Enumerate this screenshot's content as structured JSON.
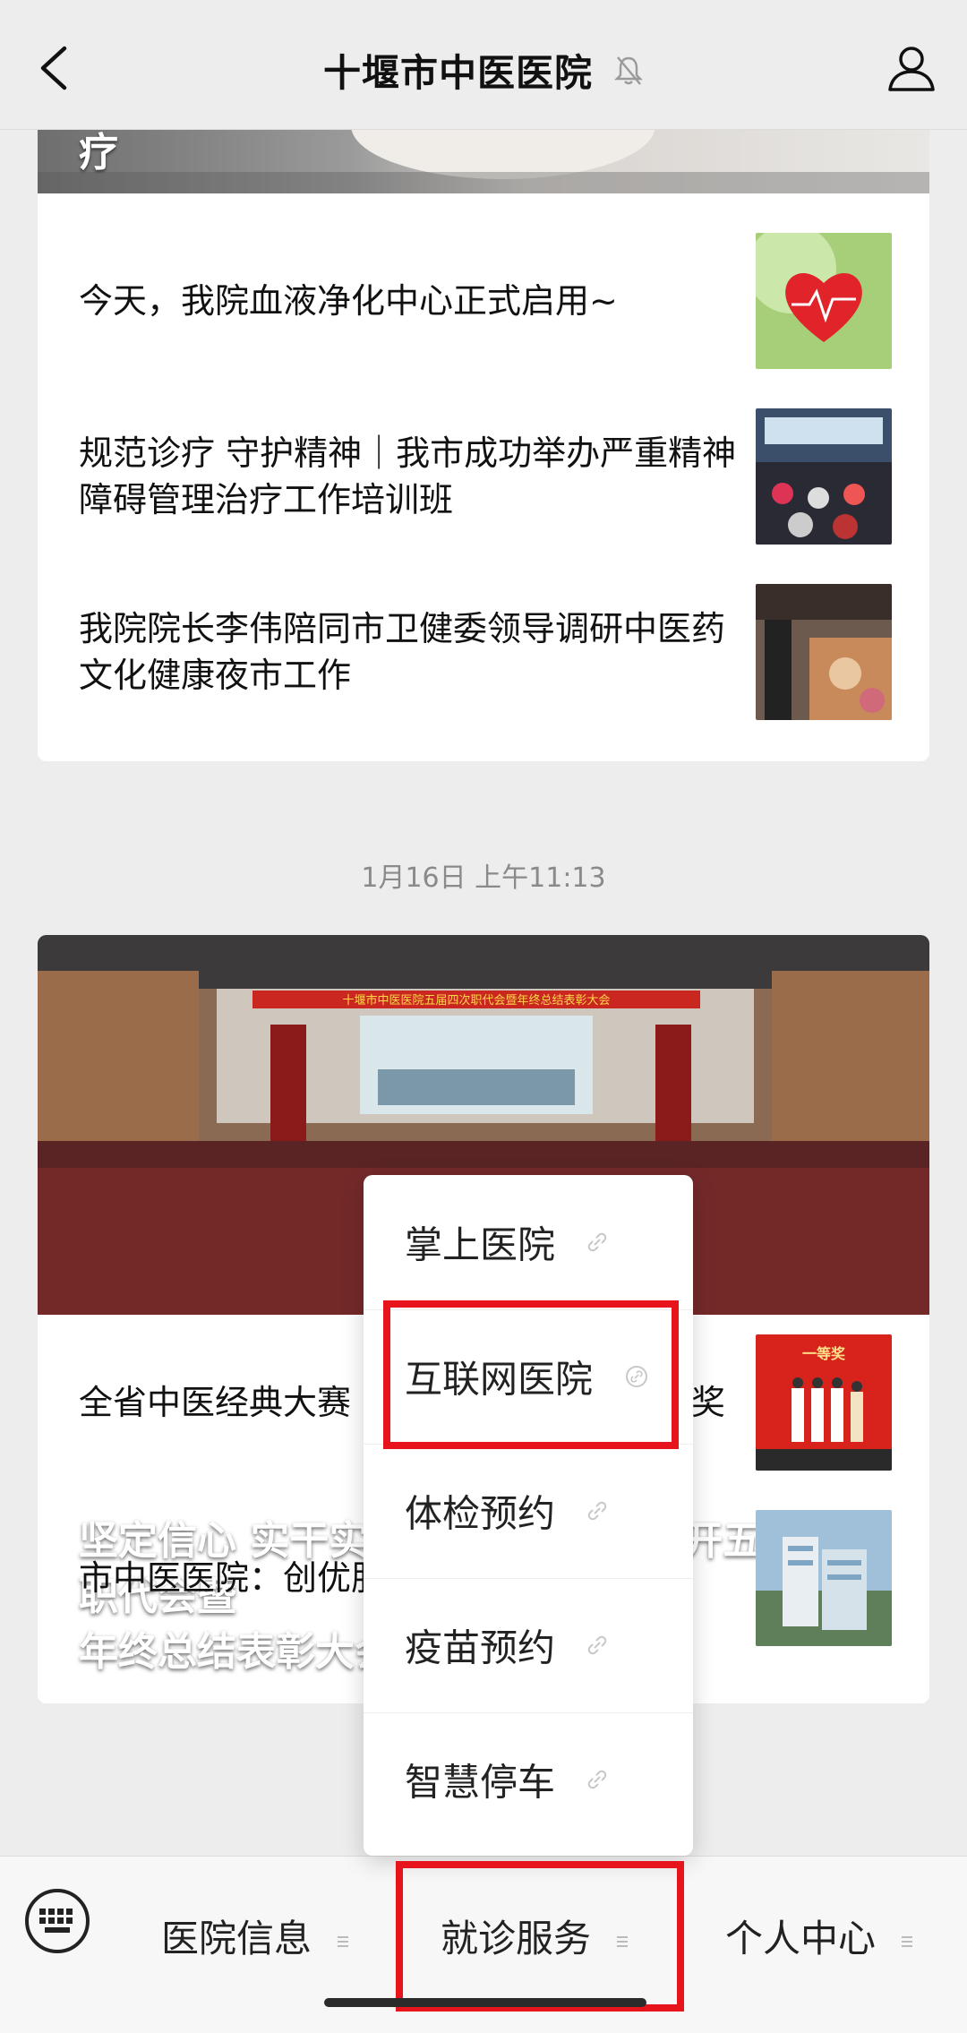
{
  "header": {
    "title": "十堰市中医医院"
  },
  "first_card": {
    "hero_caption_fragment": "疗",
    "news": [
      {
        "title": "今天，我院血液净化中心正式启用~"
      },
      {
        "title": "规范诊疗 守护精神｜我市成功举办严重精神障碍管理治疗工作培训班"
      },
      {
        "title": "我院院长李伟陪同市卫健委领导调研中医药文化健康夜市工作"
      }
    ]
  },
  "timestamp": "1月16日 上午11:13",
  "second_card": {
    "hero_caption_line1": "坚定信心 实干实效｜市中医医院召开五届四次职代会暨",
    "hero_caption_line2": "年终总结表彰大会",
    "stage_banner": "十堰市中医医院五届四次职代会暨年终总结表彰大会",
    "news": [
      {
        "title": "全省中医经典大赛｜我院代表队荣获一等奖"
      },
      {
        "title": "市中医医院：创优服务 展现实力"
      }
    ],
    "thumb_text": "一等奖"
  },
  "popup_menu": {
    "items": [
      {
        "label": "掌上医院"
      },
      {
        "label": "互联网医院"
      },
      {
        "label": "体检预约"
      },
      {
        "label": "疫苗预约"
      },
      {
        "label": "智慧停车"
      }
    ]
  },
  "bottom_tabs": [
    {
      "label": "医院信息"
    },
    {
      "label": "就诊服务"
    },
    {
      "label": "个人中心"
    }
  ],
  "colors": {
    "highlight": "#e8141b",
    "background": "#ededed",
    "card": "#ffffff"
  },
  "icons": [
    "back-arrow-icon",
    "mute-bell-icon",
    "person-icon",
    "keyboard-icon",
    "link-icon",
    "menu-handle-icon"
  ]
}
